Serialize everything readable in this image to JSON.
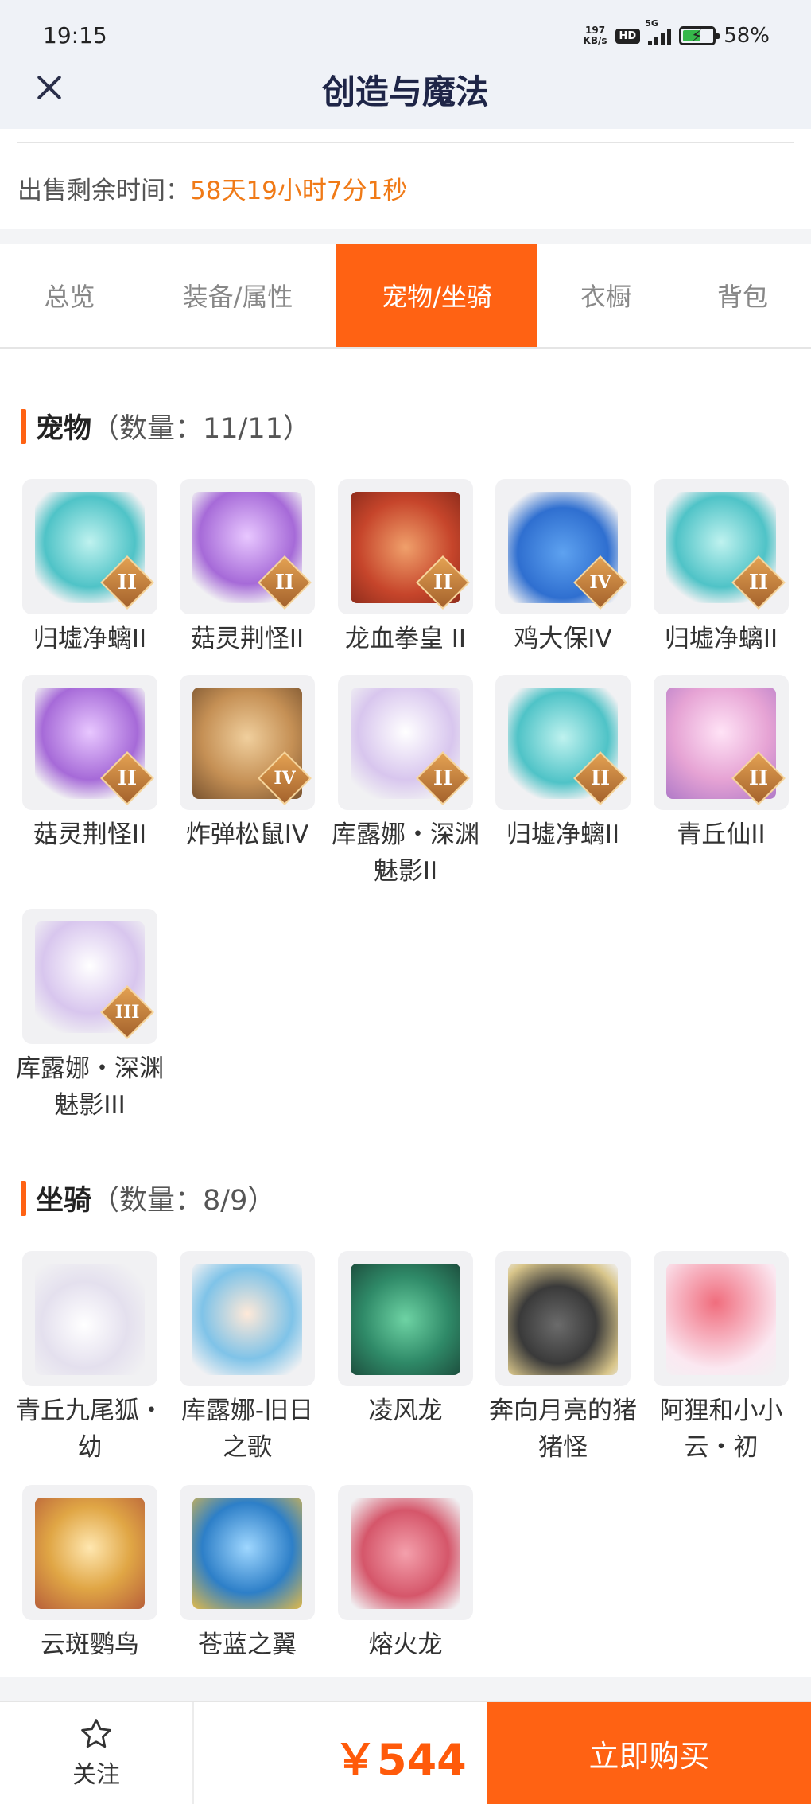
{
  "status_bar": {
    "time": "19:15",
    "net_speed_value": "197",
    "net_speed_unit": "KB/s",
    "hd": "HD",
    "network": "5G",
    "battery": "58%"
  },
  "header": {
    "title": "创造与魔法"
  },
  "sale": {
    "label": "出售剩余时间：",
    "remaining": "58天19小时7分1秒"
  },
  "tabs": [
    {
      "label": "总览",
      "active": false
    },
    {
      "label": "装备/属性",
      "active": false
    },
    {
      "label": "宠物/坐骑",
      "active": true
    },
    {
      "label": "衣橱",
      "active": false
    },
    {
      "label": "背包",
      "active": false
    }
  ],
  "pets": {
    "title": "宠物",
    "count": "（数量：11/11）",
    "items": [
      {
        "name": "归墟净螭II",
        "rank": "II",
        "icon": "azure-dragon-pet-icon",
        "color": "#4fc3c7"
      },
      {
        "name": "菇灵荆怪II",
        "rank": "II",
        "icon": "purple-haired-sprite-pet-icon",
        "color": "#a66ad8"
      },
      {
        "name": "龙血拳皇 II",
        "rank": "II",
        "icon": "horned-red-beast-pet-icon",
        "color": "#c6452b"
      },
      {
        "name": "鸡大保IV",
        "rank": "IV",
        "icon": "blue-bird-pet-icon",
        "color": "#2f6fd0"
      },
      {
        "name": "归墟净螭II",
        "rank": "II",
        "icon": "azure-dragon-pet-icon",
        "color": "#4fc3c7"
      },
      {
        "name": "菇灵荆怪II",
        "rank": "II",
        "icon": "purple-haired-sprite-pet-icon",
        "color": "#a66ad8"
      },
      {
        "name": "炸弹松鼠IV",
        "rank": "IV",
        "icon": "squirrel-pet-icon",
        "color": "#c59055"
      },
      {
        "name": "库露娜・深渊魅影II",
        "rank": "II",
        "icon": "white-haired-girl-pet-icon",
        "color": "#d8c6ee"
      },
      {
        "name": "归墟净螭II",
        "rank": "II",
        "icon": "azure-dragon-pet-icon",
        "color": "#4fc3c7"
      },
      {
        "name": "青丘仙II",
        "rank": "II",
        "icon": "fox-fairy-pet-icon",
        "color": "#e6a3d4"
      },
      {
        "name": "库露娜・深渊魅影III",
        "rank": "III",
        "icon": "white-haired-girl-pet-icon",
        "color": "#d8c6ee"
      }
    ]
  },
  "mounts": {
    "title": "坐骑",
    "count": "（数量：8/9）",
    "items": [
      {
        "name": "青丘九尾狐・幼",
        "icon": "white-fox-mount-icon",
        "color": "#e4e0ee"
      },
      {
        "name": "库露娜-旧日之歌",
        "icon": "cloud-girl-mount-icon",
        "color": "#7fc3e8"
      },
      {
        "name": "凌风龙",
        "icon": "green-dragon-mount-icon",
        "color": "#2f8a68"
      },
      {
        "name": "奔向月亮的猪猪怪",
        "icon": "black-pig-mount-icon",
        "color": "#3a3a3a"
      },
      {
        "name": "阿狸和小小云・初",
        "icon": "red-fox-cloud-mount-icon",
        "color": "#f06d7d"
      },
      {
        "name": "云斑鹦鸟",
        "icon": "golden-bird-mount-icon",
        "color": "#e0a645"
      },
      {
        "name": "苍蓝之翼",
        "icon": "blue-griffin-mount-icon",
        "color": "#2d7fc8"
      },
      {
        "name": "熔火龙",
        "icon": "red-dragon-mount-icon",
        "color": "#d5566a"
      }
    ]
  },
  "bottom": {
    "follow_label": "关注",
    "price": "￥544",
    "buy_label": "立即购买"
  },
  "colors": {
    "accent": "#ff6213",
    "countdown": "#f07a17",
    "title": "#1e2547"
  }
}
